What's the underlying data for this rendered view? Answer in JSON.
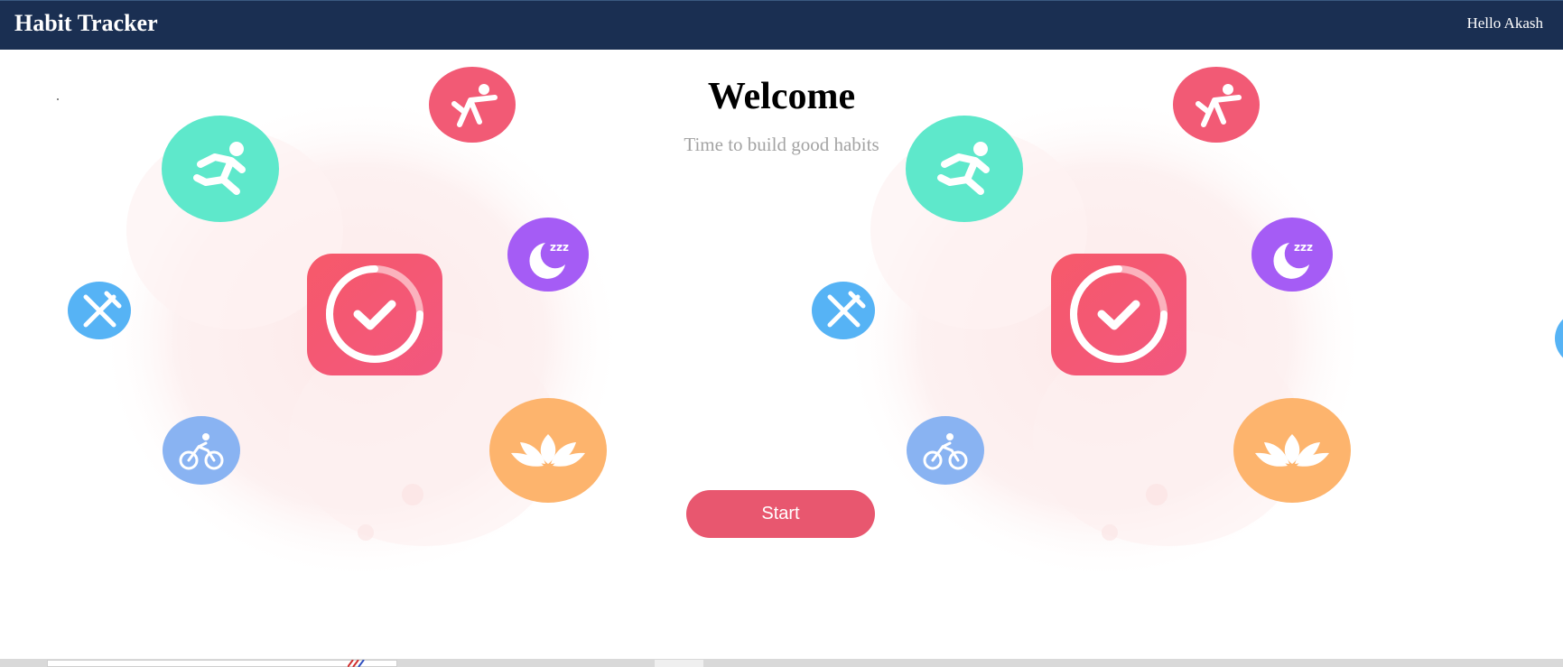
{
  "navbar": {
    "brand": "Habit Tracker",
    "greeting": "Hello Akash"
  },
  "hero": {
    "title": "Welcome",
    "subtitle": "Time to build good habits",
    "start_label": "Start"
  },
  "illustration": {
    "icons": [
      "stretch-icon",
      "running-icon",
      "sleep-icon",
      "eating-icon",
      "habit-check-icon",
      "cycling-icon",
      "meditation-icon"
    ],
    "sleep_text": "zzz",
    "colors": {
      "stretch": "#f25a75",
      "running": "#5ee8cb",
      "sleep": "#a55cf5",
      "eating": "#56b3f5",
      "check": "#f25a73",
      "cycling": "#89b3f2",
      "meditation": "#fdb46d",
      "blob": "#fdeeee"
    }
  },
  "theme": {
    "navbar_bg": "#1a2f52",
    "button_bg": "#e8576f",
    "subtitle_color": "#a3a3a3"
  }
}
